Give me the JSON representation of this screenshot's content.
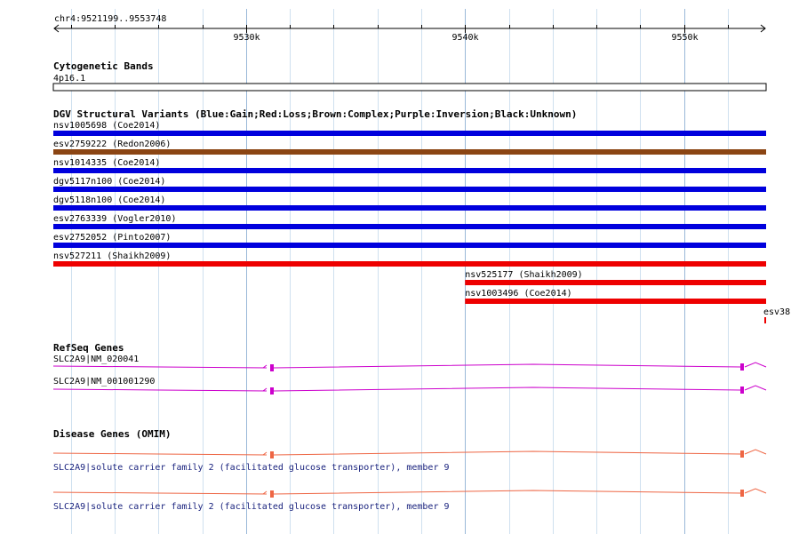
{
  "ruler": {
    "range_label": "chr4:9521199..9553748",
    "ticks": [
      {
        "label": "9530k",
        "pos": 9530000
      },
      {
        "label": "9540k",
        "pos": 9540000
      },
      {
        "label": "9550k",
        "pos": 9550000
      }
    ]
  },
  "genome": {
    "start": 9521199,
    "end": 9553748
  },
  "tracks": {
    "cytoband": {
      "title": "Cytogenetic Bands",
      "band_label": "4p16.1"
    },
    "dgv": {
      "title": "DGV Structural Variants (Blue:Gain;Red:Loss;Brown:Complex;Purple:Inversion;Black:Unknown)",
      "colors": {
        "gain": "#0000dd",
        "loss": "#ee0000",
        "complex": "#8b4513"
      },
      "items": [
        {
          "label": "nsv1005698 (Coe2014)",
          "type": "gain",
          "start": 9521199,
          "end": 9553748
        },
        {
          "label": "esv2759222 (Redon2006)",
          "type": "complex",
          "start": 9521199,
          "end": 9553748
        },
        {
          "label": "nsv1014335 (Coe2014)",
          "type": "gain",
          "start": 9521199,
          "end": 9553748
        },
        {
          "label": "dgv5117n100 (Coe2014)",
          "type": "gain",
          "start": 9521199,
          "end": 9553748
        },
        {
          "label": "dgv5118n100 (Coe2014)",
          "type": "gain",
          "start": 9521199,
          "end": 9553748
        },
        {
          "label": "esv2763339 (Vogler2010)",
          "type": "gain",
          "start": 9521199,
          "end": 9553748
        },
        {
          "label": "esv2752052 (Pinto2007)",
          "type": "gain",
          "start": 9521199,
          "end": 9553748
        },
        {
          "label": "nsv527211 (Shaikh2009)",
          "type": "loss",
          "start": 9521199,
          "end": 9553748
        },
        {
          "label": "nsv525177 (Shaikh2009)",
          "type": "loss",
          "start": 9540000,
          "end": 9553748
        },
        {
          "label": "nsv1003496 (Coe2014)",
          "type": "loss",
          "start": 9540000,
          "end": 9553748
        },
        {
          "label": "esv38",
          "type": "loss",
          "start": 9553700,
          "end": 9553748
        }
      ]
    },
    "refseq": {
      "title": "RefSeq Genes",
      "color": "#cc00cc",
      "items": [
        {
          "label": "SLC2A9|NM_020041"
        },
        {
          "label": "SLC2A9|NM_001001290"
        }
      ]
    },
    "omim": {
      "title": "Disease Genes (OMIM)",
      "color": "#ee6644",
      "items": [
        {
          "label": "SLC2A9|solute carrier family 2 (facilitated glucose transporter), member 9"
        },
        {
          "label": "SLC2A9|solute carrier family 2 (facilitated glucose transporter), member 9"
        }
      ]
    }
  }
}
